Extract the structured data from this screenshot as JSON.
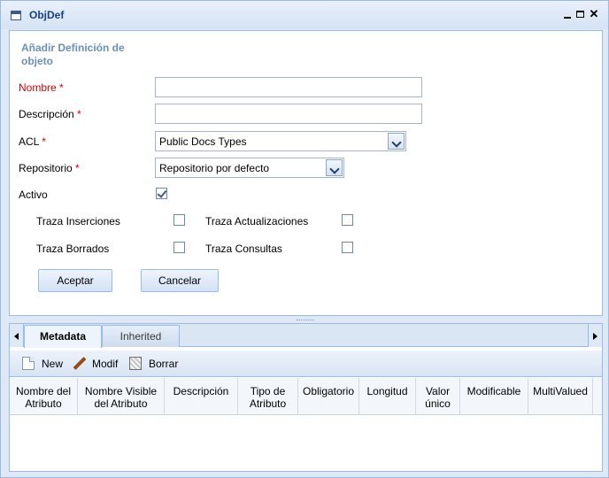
{
  "window": {
    "title": "ObjDef"
  },
  "form": {
    "heading": "Añadir Definición de objeto",
    "fields": {
      "nombre_label": "Nombre",
      "descripcion_label": "Descripción",
      "acl_label": "ACL",
      "acl_value": "Public Docs Types",
      "repositorio_label": "Repositorio",
      "repositorio_value": "Repositorio por defecto",
      "activo_label": "Activo",
      "required_mark": "*"
    },
    "options": {
      "traza_inserciones": "Traza Inserciones",
      "traza_actualizaciones": "Traza Actualizaciones",
      "traza_borrados": "Traza Borrados",
      "traza_consultas": "Traza Consultas"
    },
    "buttons": {
      "aceptar": "Aceptar",
      "cancelar": "Cancelar"
    }
  },
  "tabs": [
    {
      "label": "Metadata"
    },
    {
      "label": "Inherited"
    }
  ],
  "toolbar": {
    "new": "New",
    "modif": "Modif",
    "borrar": "Borrar"
  },
  "grid": {
    "columns": [
      {
        "line1": "Nombre del",
        "line2": "Atributo"
      },
      {
        "line1": "Nombre Visible",
        "line2": "del Atributo"
      },
      {
        "line1": "Descripción",
        "line2": ""
      },
      {
        "line1": "Tipo de",
        "line2": "Atributo"
      },
      {
        "line1": "Obligatorio",
        "line2": ""
      },
      {
        "line1": "Longitud",
        "line2": ""
      },
      {
        "line1": "Valor",
        "line2": "único"
      },
      {
        "line1": "Modificable",
        "line2": ""
      },
      {
        "line1": "MultiValued",
        "line2": ""
      }
    ]
  }
}
